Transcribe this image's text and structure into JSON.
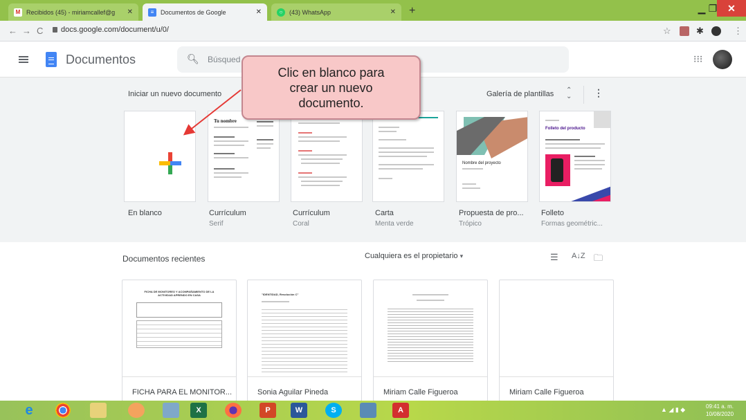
{
  "browser": {
    "tabs": [
      {
        "title": "Recibidos (45) - miriamcallef@g",
        "favicon": "gmail-icon",
        "color": "#d93025",
        "active": false
      },
      {
        "title": "Documentos de Google",
        "favicon": "docs-icon",
        "color": "#4285f4",
        "active": true
      },
      {
        "title": "(43) WhatsApp",
        "favicon": "whatsapp-icon",
        "color": "#25d366",
        "active": false
      }
    ],
    "new_tab": "+",
    "url": "docs.google.com/document/u/0/"
  },
  "header": {
    "app_title": "Documentos",
    "search_placeholder": "Búsqued"
  },
  "templates": {
    "section_title": "Iniciar un nuevo documento",
    "gallery_label": "Galería de plantillas",
    "items": [
      {
        "name": "En blanco",
        "subtitle": ""
      },
      {
        "name": "Currículum",
        "subtitle": "Serif",
        "heading": "Tu nombre"
      },
      {
        "name": "Currículum",
        "subtitle": "Coral"
      },
      {
        "name": "Carta",
        "subtitle": "Menta verde"
      },
      {
        "name": "Propuesta de pro...",
        "subtitle": "Trópico",
        "heading": "Nombre del proyecto"
      },
      {
        "name": "Folleto",
        "subtitle": "Formas geométric...",
        "heading": "Folleto del producto"
      }
    ]
  },
  "recent": {
    "title": "Documentos recientes",
    "owner_filter": "Cualquiera es el propietario",
    "docs": [
      {
        "name": "FICHA PARA EL MONITOR...",
        "heading": "FICHA DE MONITOREO Y ACOMPAÑAMIENTO DE LA ACTIVIDAD APRENDO EN CASA"
      },
      {
        "name": "Sonia Aguilar Pineda",
        "heading": "\"IDENTIDAD, Resolución C\""
      },
      {
        "name": "Miriam Calle Figueroa",
        "heading": ""
      },
      {
        "name": "Miriam Calle Figueroa",
        "heading": ""
      }
    ]
  },
  "callout": {
    "line1": "Clic en blanco para",
    "line2": "crear un nuevo",
    "line3": "documento."
  },
  "taskbar": {
    "time": "09:41 a. m.",
    "date": "10/08/2020",
    "icons": [
      "ie-icon",
      "chrome-icon",
      "explorer-icon",
      "paint-icon",
      "notepad-icon",
      "excel-icon",
      "firefox-icon",
      "powerpoint-icon",
      "word-icon",
      "skype-icon",
      "monitor-icon",
      "acrobat-icon"
    ]
  },
  "colors": {
    "accent": "#4285f4",
    "plus_red": "#ea4335",
    "plus_yellow": "#fbbc04",
    "plus_green": "#34a853",
    "plus_blue": "#4285f4",
    "callout_bg": "#f8c8c8",
    "arrow": "#e53935"
  }
}
